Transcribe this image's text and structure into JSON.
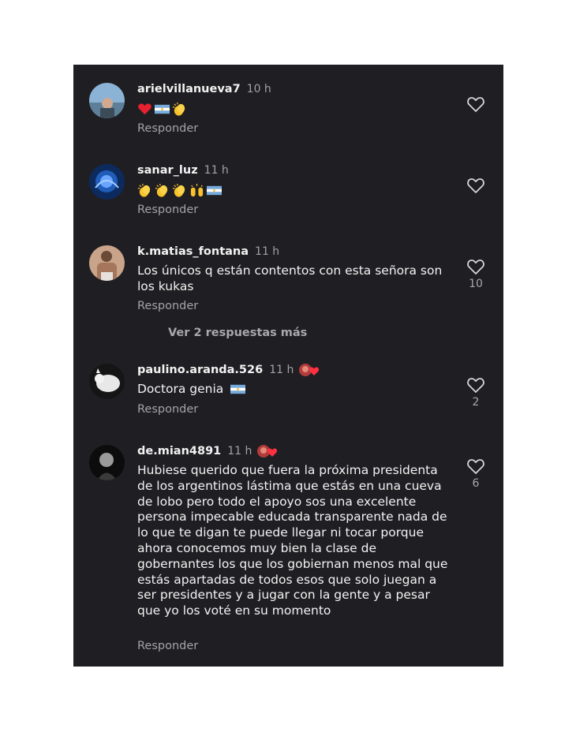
{
  "comments": [
    {
      "username": "arielvillanueva7",
      "time": "10 h",
      "emojis": [
        "red-heart",
        "argentina-flag",
        "clapping-hands"
      ],
      "text": "",
      "reply": "Responder",
      "likes": ""
    },
    {
      "username": "sanar_luz",
      "time": "11 h",
      "emojis": [
        "clapping-hands",
        "clapping-hands",
        "clapping-hands",
        "raising-hands",
        "argentina-flag"
      ],
      "text": "",
      "reply": "Responder",
      "likes": ""
    },
    {
      "username": "k.matias_fontana",
      "time": "11 h",
      "text": "Los únicos q están contentos con esta señora son los kukas",
      "reply": "Responder",
      "likes": "10"
    },
    {
      "username": "paulino.aranda.526",
      "time": "11 h",
      "text": "Doctora genia",
      "reply": "Responder",
      "likes": "2"
    },
    {
      "username": "de.mian4891",
      "time": "11 h",
      "text": "Hubiese querido que fuera la próxima presidenta de los argentinos lástima que estás en una cueva de lobo pero todo el apoyo sos una excelente persona impecable educada transparente nada de lo que te digan te puede llegar ni tocar porque ahora conocemos muy bien la clase de gobernantes los que los gobiernan menos mal que estás apartadas de todos esos que solo juegan a ser presidentes y a jugar con la gente y a pesar que yo los voté en su momento",
      "reply": "Responder",
      "likes": "6"
    }
  ],
  "more_replies": "Ver 2 respuestas más",
  "colors": {
    "background": "#1f1f23",
    "username": "#f2f2f2",
    "secondary": "#a0a0a5",
    "body": "#f3f3f3"
  }
}
